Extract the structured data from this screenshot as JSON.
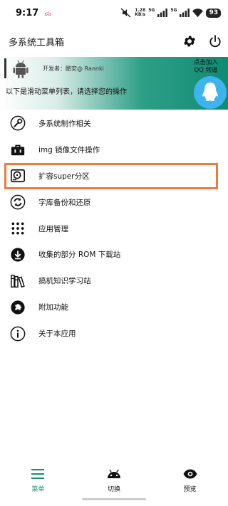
{
  "status_bar": {
    "time": "9:17",
    "notification": "ᯅ",
    "speed_value": "1.28",
    "speed_unit": "KB/s",
    "net1": "5G",
    "net2": "5G",
    "battery": "93"
  },
  "app_bar": {
    "title": "多系统工具箱",
    "settings_icon": "gear-icon",
    "power_icon": "power-icon"
  },
  "banner": {
    "developer": "开发者：酷安@ Rannki",
    "description": "以下是滑动菜单列表，请选择您的操作",
    "qq_label_line1": "点击加入",
    "qq_label_line2": "QQ 频道"
  },
  "menu": {
    "items": [
      {
        "label": "多系统制作相关",
        "icon": "wrench-icon"
      },
      {
        "label": "img 镜像文件操作",
        "icon": "toolbox-icon"
      },
      {
        "label": "扩容super分区",
        "icon": "hard-drive-icon",
        "selected": true
      },
      {
        "label": "字库备份和还原",
        "icon": "sync-icon"
      },
      {
        "label": "应用管理",
        "icon": "grid-dots-icon"
      },
      {
        "label": "收集的部分 ROM 下载站",
        "icon": "download-circle-icon"
      },
      {
        "label": "搞机知识学习站",
        "icon": "books-icon"
      },
      {
        "label": "附加功能",
        "icon": "puzzle-icon"
      },
      {
        "label": "关于本应用",
        "icon": "info-icon"
      }
    ]
  },
  "bottom_nav": {
    "items": [
      {
        "label": "菜单",
        "icon": "menu-icon",
        "active": true
      },
      {
        "label": "切换",
        "icon": "android-icon"
      },
      {
        "label": "预览",
        "icon": "eye-icon"
      }
    ],
    "active_color": "#1a8f6e",
    "selection_color": "#f07a3a"
  }
}
